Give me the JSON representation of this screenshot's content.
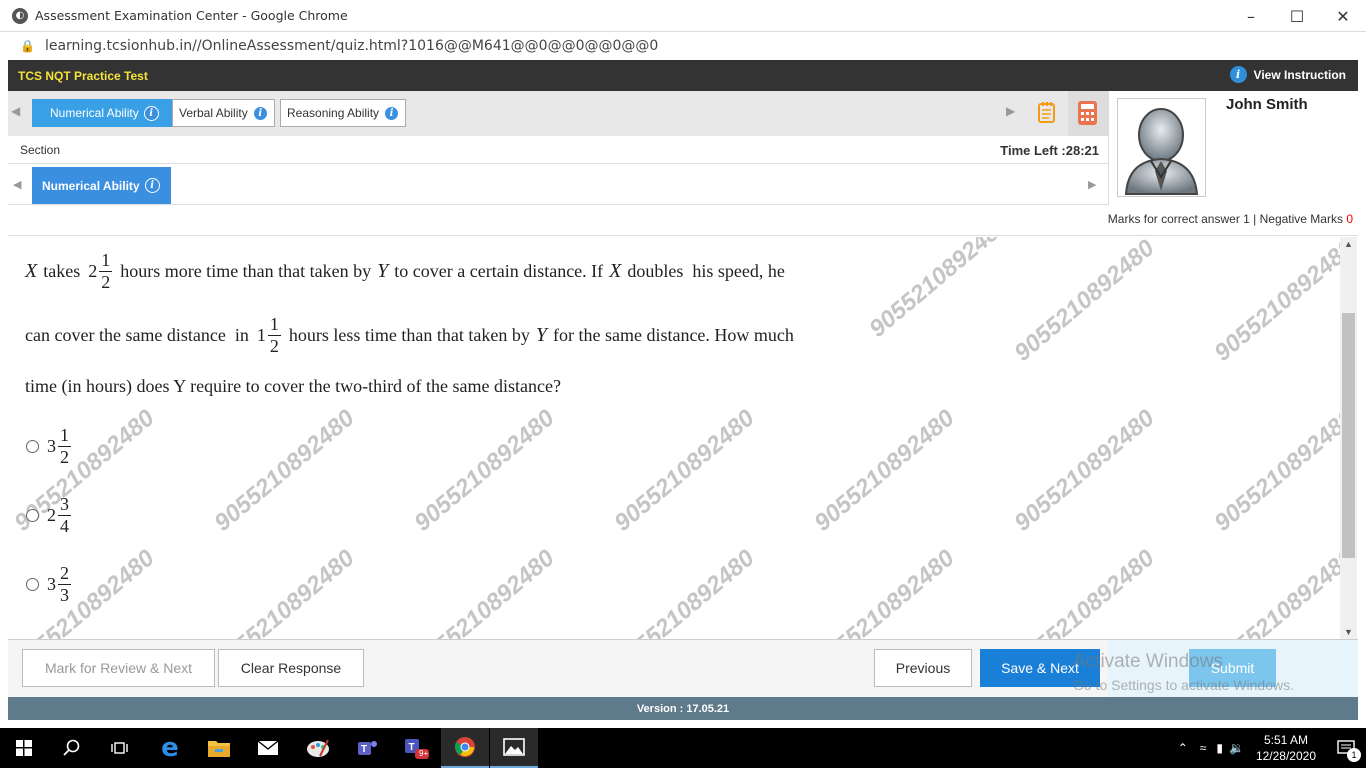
{
  "browser": {
    "title": "Assessment Examination Center - Google Chrome",
    "url": "learning.tcsionhub.in//OnlineAssessment/quiz.html?1016@@M641@@0@@0@@0@@0"
  },
  "header": {
    "test_name": "TCS NQT Practice Test",
    "view_instruction": "View Instruction"
  },
  "tabs": [
    {
      "label": "Numerical Ability",
      "active": true
    },
    {
      "label": "Verbal Ability",
      "active": false
    },
    {
      "label": "Reasoning Ability",
      "active": false
    }
  ],
  "section": {
    "label": "Section",
    "time_left": "Time Left :28:21",
    "current": "Numerical Ability"
  },
  "profile": {
    "name": "John Smith"
  },
  "marks": {
    "text": "Marks for correct answer 1 | Negative Marks ",
    "negative": "0"
  },
  "question": {
    "line1": {
      "var_x": "X",
      "t1": "takes",
      "whole": "2",
      "num": "1",
      "den": "2",
      "t2": "hours more time than that taken by",
      "var_y": "Y",
      "t3": "to cover a certain distance. If",
      "var_x2": "X",
      "t4": "doubles  his speed, he"
    },
    "line2": {
      "t1": "can cover the same distance  in",
      "whole": "1",
      "num": "1",
      "den": "2",
      "t2": "hours less time than that taken by",
      "var_y": "Y",
      "t3": "for the same distance. How much"
    },
    "line3": "time (in hours) does Y require to cover the two-third of the same distance?"
  },
  "options": [
    {
      "whole": "3",
      "num": "1",
      "den": "2"
    },
    {
      "whole": "2",
      "num": "3",
      "den": "4"
    },
    {
      "whole": "3",
      "num": "2",
      "den": "3"
    }
  ],
  "watermark": "9055210892480",
  "buttons": {
    "mark_review": "Mark for Review & Next",
    "clear": "Clear Response",
    "previous": "Previous",
    "save_next": "Save & Next",
    "submit": "Submit"
  },
  "activate_windows": {
    "title": "Activate Windows",
    "subtitle": "Go to Settings to activate Windows."
  },
  "version": "Version : 17.05.21",
  "taskbar": {
    "time": "5:51 AM",
    "date": "12/28/2020",
    "notification_count": "1",
    "teams_badge": "9+"
  }
}
